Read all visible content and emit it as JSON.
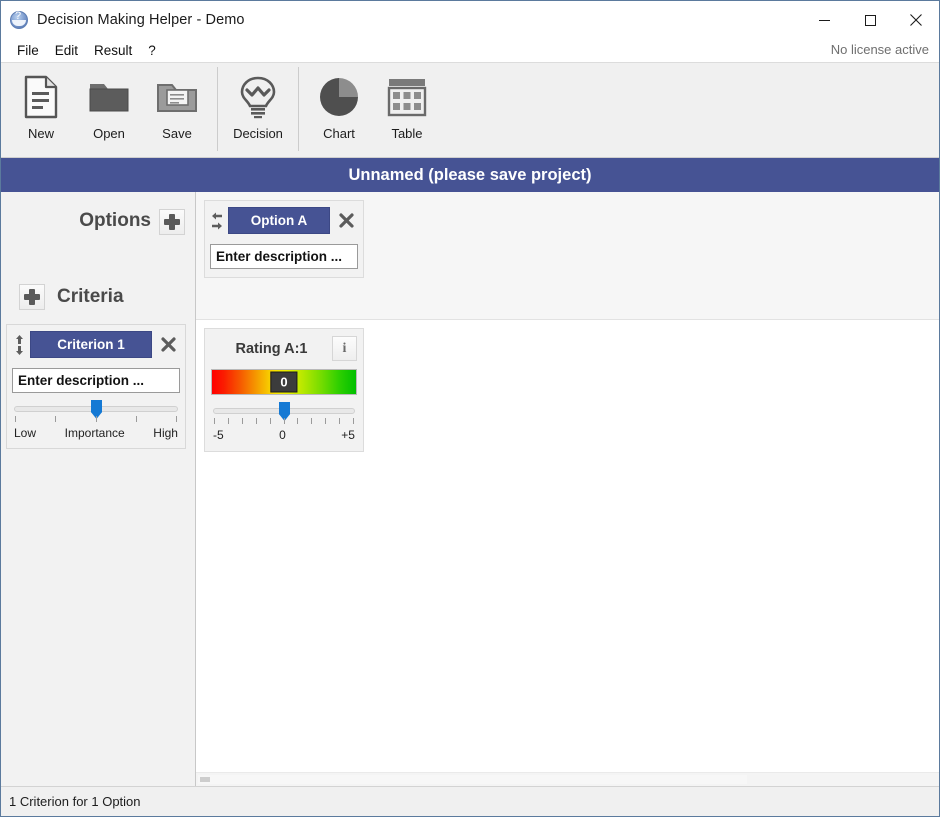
{
  "window": {
    "title": "Decision Making Helper - Demo",
    "app_icon": "globe-question-icon",
    "minimize_label": "–",
    "maximize_label": "□",
    "close_label": "×"
  },
  "menubar": {
    "items": [
      {
        "label": "File"
      },
      {
        "label": "Edit"
      },
      {
        "label": "Result"
      },
      {
        "label": "?"
      }
    ],
    "license_status": "No license active"
  },
  "toolbar": {
    "buttons": [
      {
        "label": "New",
        "icon": "document-icon"
      },
      {
        "label": "Open",
        "icon": "folder-open-icon"
      },
      {
        "label": "Save",
        "icon": "folder-save-icon"
      },
      {
        "label": "Decision",
        "icon": "lightbulb-icon"
      },
      {
        "label": "Chart",
        "icon": "pie-chart-icon"
      },
      {
        "label": "Table",
        "icon": "table-grid-icon"
      }
    ],
    "separator_after": [
      2,
      3
    ]
  },
  "project": {
    "title": "Unnamed (please save project)",
    "title_bar_color": "#465394"
  },
  "sidebar": {
    "options_label": "Options",
    "options_add_icon": "plus-icon",
    "criteria_label": "Criteria",
    "criteria_add_icon": "plus-icon",
    "criteria": [
      {
        "name": "Criterion 1",
        "description_value": "Enter description ...",
        "reorder_up_icon": "arrow-up-icon",
        "reorder_down_icon": "arrow-down-icon",
        "close_icon": "close-icon",
        "slider": {
          "value_percent": 50,
          "tick_count": 5,
          "label_left": "Low",
          "label_center": "Importance",
          "label_right": "High"
        }
      }
    ]
  },
  "main": {
    "options": [
      {
        "name": "Option A",
        "description_value": "Enter description ...",
        "reorder_left_icon": "arrow-left-icon",
        "reorder_right_icon": "arrow-right-icon",
        "close_icon": "close-icon"
      }
    ],
    "ratings": [
      {
        "title": "Rating A:1",
        "info_icon": "info-icon",
        "info_label": "i",
        "value": "0",
        "slider": {
          "value_percent": 50,
          "tick_count": 11,
          "label_left": "-5",
          "label_center": "0",
          "label_right": "+5"
        },
        "gradient": {
          "from": "#ff0000",
          "mid": "#f8e400",
          "to": "#00c000"
        }
      }
    ]
  },
  "statusbar": {
    "text": "1 Criterion for 1 Option"
  }
}
